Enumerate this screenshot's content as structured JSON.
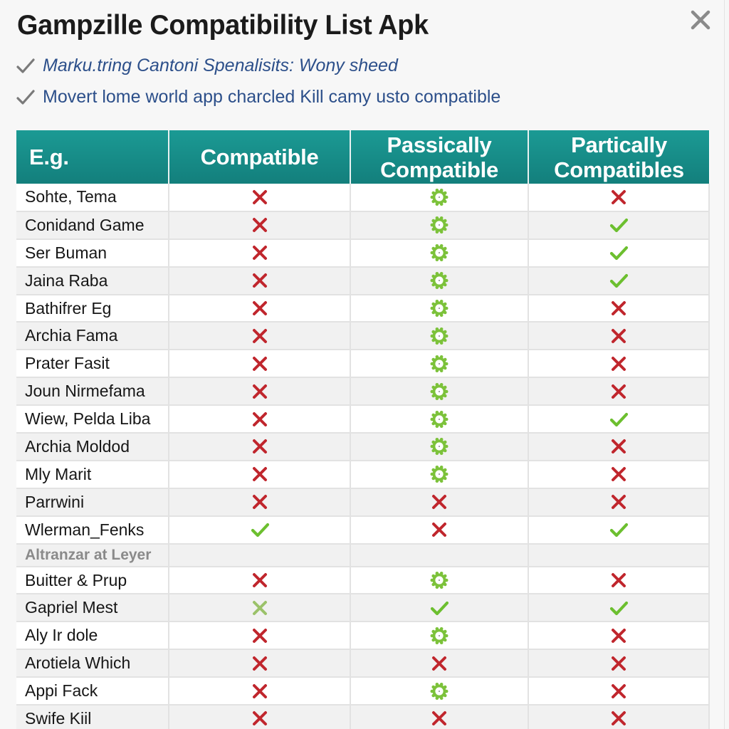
{
  "header": {
    "title": "Gampzille Compatibility List Apk",
    "close_icon": "close-icon"
  },
  "bullets": [
    {
      "icon": "checkmark-icon",
      "text": "Marku.tring Cantoni Spenalisits: Wony sheed"
    },
    {
      "icon": "checkmark-icon",
      "text": "Movert lome world app charcled Kill camy usto compatible"
    }
  ],
  "colors": {
    "header_teal": "#16908b",
    "cross_red": "#c0262d",
    "check_green": "#6cbf2f",
    "gear_green": "#7cc23a",
    "faded_cross_green": "#9bc26a",
    "bullet_text": "#2c4f8a"
  },
  "table": {
    "columns": [
      "E.g.",
      "Compatible",
      "Passically Compatible",
      "Partically Compatibles"
    ],
    "columns_lines": [
      [
        "E.g."
      ],
      [
        "Compatible"
      ],
      [
        "Passically",
        "Compatible"
      ],
      [
        "Partically",
        "Compatibles"
      ]
    ],
    "status_icon_legend": {
      "cross": "cross-icon",
      "check": "checkmark-icon",
      "gear": "gear-icon",
      "faded_cross": "cross-icon"
    },
    "rows": [
      {
        "name": "Sohte, Tema",
        "cells": [
          "cross",
          "gear",
          "cross"
        ]
      },
      {
        "name": "Conidand Game",
        "cells": [
          "cross",
          "gear",
          "check"
        ]
      },
      {
        "name": "Ser Buman",
        "cells": [
          "cross",
          "gear",
          "check"
        ]
      },
      {
        "name": "Jaina Raba",
        "cells": [
          "cross",
          "gear",
          "check"
        ]
      },
      {
        "name": "Bathifrer Eg",
        "cells": [
          "cross",
          "gear",
          "cross"
        ]
      },
      {
        "name": "Archia Fama",
        "cells": [
          "cross",
          "gear",
          "cross"
        ]
      },
      {
        "name": "Prater Fasit",
        "cells": [
          "cross",
          "gear",
          "cross"
        ]
      },
      {
        "name": "Joun Nirmefama",
        "cells": [
          "cross",
          "gear",
          "cross"
        ]
      },
      {
        "name": "Wiew, Pelda Liba",
        "cells": [
          "cross",
          "gear",
          "check"
        ]
      },
      {
        "name": "Archia Moldod",
        "cells": [
          "cross",
          "gear",
          "cross"
        ]
      },
      {
        "name": "Mly Marit",
        "cells": [
          "cross",
          "gear",
          "cross"
        ]
      },
      {
        "name": "Parrwini",
        "cells": [
          "cross",
          "cross",
          "cross"
        ]
      },
      {
        "name": "Wlerman_Fenks",
        "cells": [
          "check",
          "cross",
          "check"
        ]
      },
      {
        "name": "Altranzar at Leyer",
        "section": true,
        "cells": [
          "",
          "",
          ""
        ]
      },
      {
        "name": "Buitter & Prup",
        "cells": [
          "cross",
          "gear",
          "cross"
        ]
      },
      {
        "name": "Gapriel Mest",
        "cells": [
          "faded_cross",
          "check",
          "check"
        ]
      },
      {
        "name": "Aly Ir dole",
        "cells": [
          "cross",
          "gear",
          "cross"
        ]
      },
      {
        "name": "Arotiela Which",
        "cells": [
          "cross",
          "cross",
          "cross"
        ]
      },
      {
        "name": "Appi Fack",
        "cells": [
          "cross",
          "gear",
          "cross"
        ]
      },
      {
        "name": "Swife Kiil",
        "cells": [
          "cross",
          "cross",
          "cross"
        ]
      }
    ]
  }
}
